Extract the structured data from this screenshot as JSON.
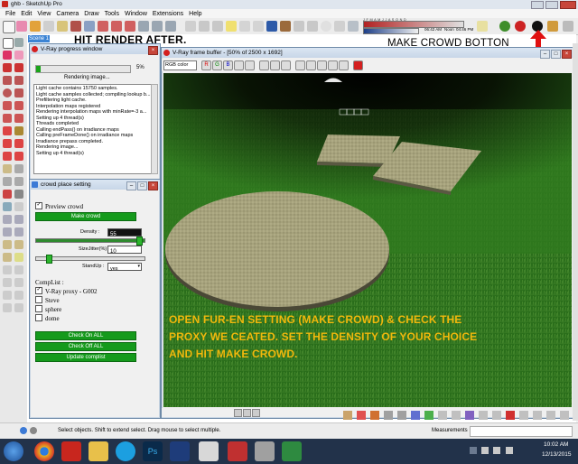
{
  "app": {
    "title": "ghb - SketchUp Pro",
    "scene_tab": "Scene 1"
  },
  "menu": [
    "File",
    "Edit",
    "View",
    "Camera",
    "Draw",
    "Tools",
    "Window",
    "Extensions",
    "Help"
  ],
  "annotations": {
    "render_note": "HIT RENDER AFTER.",
    "crowd_note": "MAKE CROWD BOTTON",
    "instructions": "OPEN FUR-EN SETTING (MAKE CROWD) & CHECK THE PROXY WE CEATED. SET THE DENSITY OF YOUR CHOICE AND HIT MAKE CROWD.",
    "note_color": "#f2b80c"
  },
  "shadow_bar": {
    "time_left": "06:42 AM",
    "noon": "Noon",
    "time_right": "04:46 PM",
    "month": "J F M A M J J A S O N D"
  },
  "progress_window": {
    "title": "V-Ray progress window",
    "percent": "5%",
    "progress_fraction": 0.05,
    "status": "Rendering image...",
    "log": [
      "Light cache contains 15750 samples.",
      "Light cache samples collected; compiling lookup b...",
      "Prefiltering light cache.",
      "Interpolation maps registered",
      "Rendering interpolation maps with minRate=-3 a...",
      "Setting up 4 thread(s)",
      "Threads completed",
      "Calling endPass() on irradiance maps",
      "Calling preFrameDone() on irradiance maps",
      "Irradiance prepass completed.",
      "Rendering image...",
      "Setting up 4 thread(s)"
    ]
  },
  "crowd_window": {
    "title": "crowd place setting",
    "preview_label": "Preview crowd",
    "make_crowd_label": "Make crowd",
    "density_label": "Density :",
    "density_value": "55",
    "density_fraction": 0.95,
    "size_label": "SizeJitter(%) :",
    "size_value": "10",
    "size_fraction": 0.12,
    "standup_label": "StandUp :",
    "standup_value": "yes",
    "complist_label": "CompList :",
    "complist": [
      "V-Ray proxy - G002",
      "Steve",
      "sphere",
      "dome"
    ],
    "check_on_label": "Check On ALL",
    "check_off_label": "Check Off ALL",
    "update_label": "Update complist"
  },
  "frame_buffer": {
    "title": "V-Ray frame buffer - [50% of 2500 x 1692]",
    "channel": "RGB color"
  },
  "statusbar": {
    "hint": "Select objects. Shift to extend select. Drag mouse to select multiple.",
    "measurements": "Measurements"
  },
  "taskbar": {
    "time": "10:02 AM",
    "date": "12/13/2015"
  },
  "colors": {
    "vray_red": "#d42020",
    "progress_green": "#1aa51a",
    "grass": "#2f7a1e",
    "taskbar": "#22324a"
  }
}
